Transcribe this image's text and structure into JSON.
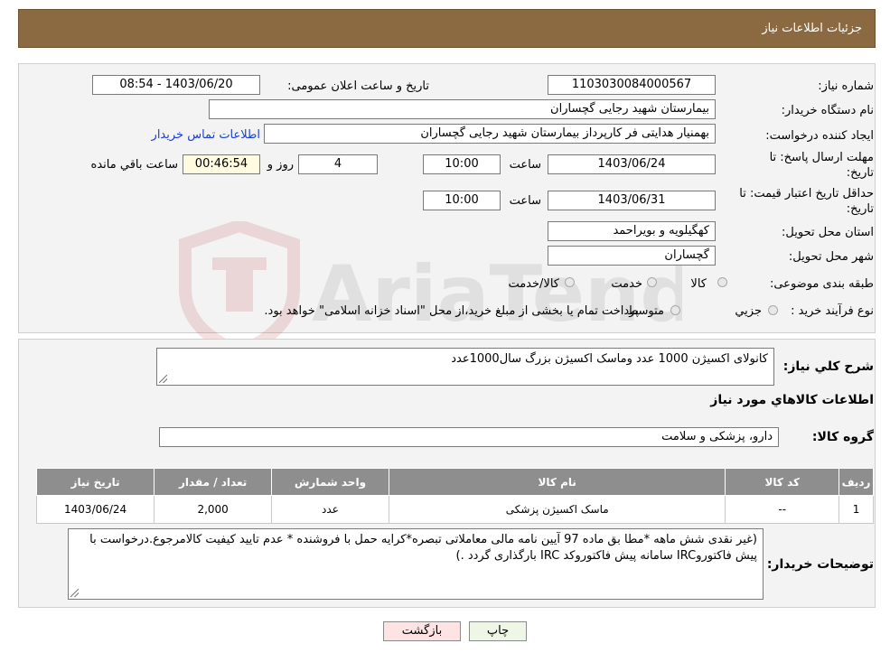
{
  "header": {
    "title": "جزئیات اطلاعات نیاز"
  },
  "form": {
    "need_number_label": "شماره نیاز:",
    "need_number": "1103030084000567",
    "announce_label": "تاریخ و ساعت اعلان عمومی:",
    "announce_value": "1403/06/20 - 08:54",
    "buyer_org_label": "نام دستگاه خریدار:",
    "buyer_org": "بیمارستان شهید رجایی گچساران",
    "creator_label": "ایجاد کننده درخواست:",
    "creator": "بهمنیار هدایتی فر کارپرداز بیمارستان شهید رجایی گچساران",
    "contact_link": "اطلاعات تماس خریدار",
    "deadline_label_1": "مهلت ارسال پاسخ: تا",
    "deadline_label_2": "تاریخ:",
    "deadline_date": "1403/06/24",
    "time_label": "ساعت",
    "deadline_time": "10:00",
    "days_value": "4",
    "days_label": "روز و",
    "remaining_time": "00:46:54",
    "remaining_label": "ساعت باقي مانده",
    "validity_label_1": "حداقل تاریخ اعتبار قیمت: تا",
    "validity_label_2": "تاریخ:",
    "validity_date": "1403/06/31",
    "validity_time": "10:00",
    "province_label": "استان محل تحویل:",
    "province": "کهگیلویه و بویراحمد",
    "city_label": "شهر محل تحویل:",
    "city": "گچساران",
    "category_label": "طبقه بندی موضوعی:",
    "category_options": [
      "کالا",
      "خدمت",
      "کالا/خدمت"
    ],
    "purchase_label": "نوع فرآیند خرید :",
    "purchase_options": [
      "جزیي",
      "متوسط"
    ],
    "purchase_note": "پرداخت تمام یا بخشی از مبلغ خرید،از محل \"اسناد خزانه اسلامی\" خواهد بود."
  },
  "summary": {
    "general_desc_label": "شرح کلي نیاز:",
    "general_desc": "کانولای اکسیژن 1000 عدد وماسک اکسیژن بزرگ سال1000عدد",
    "goods_info_title": "اطلاعات کالاهاي مورد نیاز",
    "goods_group_label": "گروه کالا:",
    "goods_group": "دارو، پزشکی و سلامت",
    "table": {
      "headers": [
        "ردیف",
        "کد کالا",
        "نام کالا",
        "واحد شمارش",
        "تعداد / مقدار",
        "تاریخ نیاز"
      ],
      "rows": [
        [
          "1",
          "--",
          "ماسک اکسیژن پزشکی",
          "عدد",
          "2,000",
          "1403/06/24"
        ]
      ]
    },
    "buyer_notes_label": "توضیحات خریدار:",
    "buyer_notes": "(غیر نقدی شش ماهه  *مطا بق ماده 97 آیین نامه مالی معاملاتی تبصره*کرایه حمل با فروشنده * عدم تایید کیفیت کالامرجوع.درخواست با پیش فاکتوروIRC سامانه  پیش فاکتوروکد IRC بارگذاری گردد .)"
  },
  "buttons": {
    "print": "چاپ",
    "back": "بازگشت"
  },
  "colors": {
    "header_bg": "#8b6a42",
    "table_header_bg": "#8e8e8e",
    "link": "#1a3fd1",
    "back_bg": "#fde3e3",
    "print_bg": "#eef7e6"
  }
}
